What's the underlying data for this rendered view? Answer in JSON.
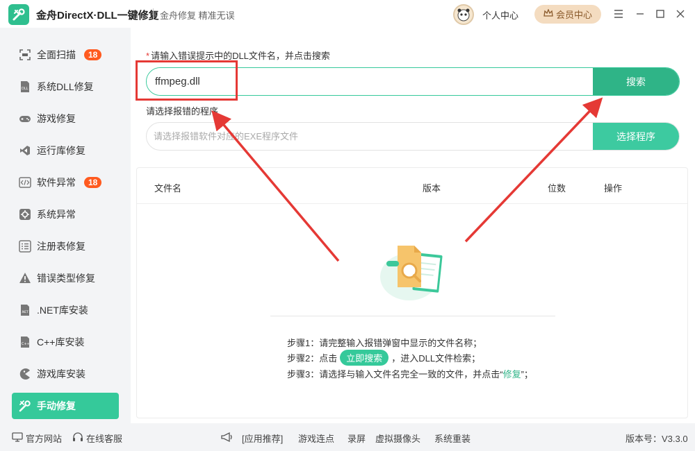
{
  "titlebar": {
    "app_title": "金舟DirectX·DLL一键修复",
    "subtitle": "金舟修复 精准无误",
    "personal_center": "个人中心",
    "vip_center": "会员中心"
  },
  "sidebar": {
    "items": [
      {
        "label": "全面扫描",
        "badge": "18",
        "icon": "scan-icon"
      },
      {
        "label": "系统DLL修复",
        "badge": "",
        "icon": "dll-icon"
      },
      {
        "label": "游戏修复",
        "badge": "",
        "icon": "gamepad-icon"
      },
      {
        "label": "运行库修复",
        "badge": "",
        "icon": "visual-studio-icon"
      },
      {
        "label": "软件异常",
        "badge": "18",
        "icon": "code-icon"
      },
      {
        "label": "系统异常",
        "badge": "",
        "icon": "gear-icon"
      },
      {
        "label": "注册表修复",
        "badge": "",
        "icon": "list-icon"
      },
      {
        "label": "错误类型修复",
        "badge": "",
        "icon": "warning-icon"
      },
      {
        "label": ".NET库安装",
        "badge": "",
        "icon": "dotnet-icon"
      },
      {
        "label": "C++库安装",
        "badge": "",
        "icon": "cpp-icon"
      },
      {
        "label": "游戏库安装",
        "badge": "",
        "icon": "pacman-icon"
      },
      {
        "label": "手动修复",
        "badge": "",
        "icon": "tools-icon"
      }
    ]
  },
  "main": {
    "prompt_star": "*",
    "prompt": "请输入错误提示中的DLL文件名，并点击搜索",
    "search_value": "ffmpeg.dll",
    "search_button": "搜索",
    "program_label": "请选择报错的程序",
    "program_placeholder": "请选择报错软件对应的EXE程序文件",
    "program_button": "选择程序",
    "table_headers": [
      "文件名",
      "版本",
      "位数",
      "操作"
    ],
    "steps": {
      "step1": "步骤1：请完整输入报错弹窗中显示的文件名称；",
      "step2_prefix": "步骤2：点击",
      "step2_pill": "立即搜索",
      "step2_suffix": "，进入DLL文件检索；",
      "step3_prefix": "步骤3：请选择与输入文件名完全一致的文件，并点击“",
      "step3_hl": "修复",
      "step3_suffix": "”；"
    }
  },
  "footer": {
    "website": "官方网站",
    "support": "在线客服",
    "recommend": "[应用推荐]",
    "links": [
      "游戏连点",
      "录屏",
      "虚拟摄像头",
      "系统重装"
    ],
    "version": "版本号：V3.3.0"
  },
  "colors": {
    "accent": "#35c99a",
    "search_button": "#2fb487",
    "badge": "#ff5a1f",
    "annotation_red": "#e53935"
  }
}
